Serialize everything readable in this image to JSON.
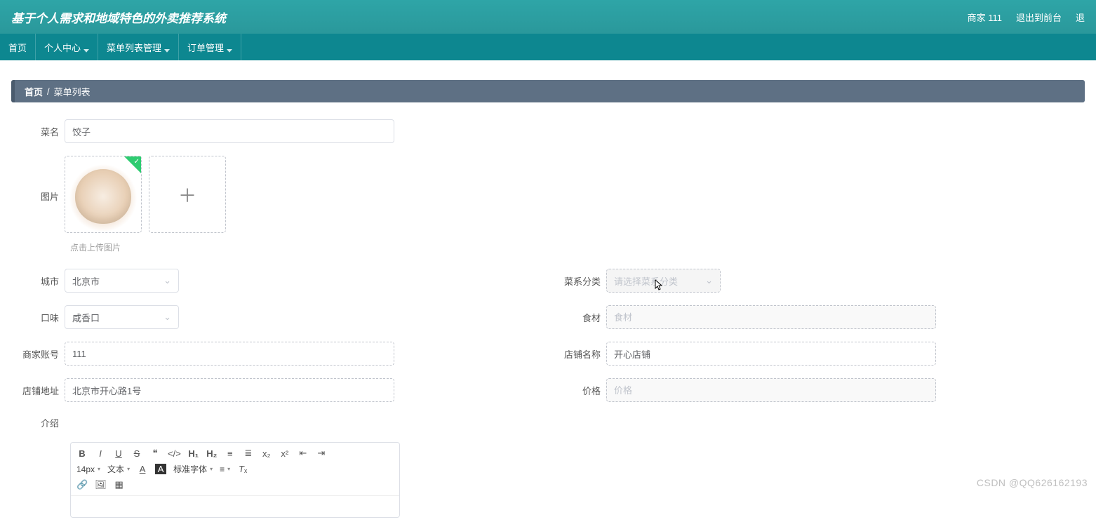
{
  "header": {
    "title": "基于个人需求和地域特色的外卖推荐系统",
    "user_label": "商家 111",
    "logout_label": "退出到前台",
    "extra_label": "退"
  },
  "nav": {
    "home": "首页",
    "personal": "个人中心",
    "menu_mgmt": "菜单列表管理",
    "order_mgmt": "订单管理"
  },
  "breadcrumb": {
    "home": "首页",
    "sep": "/",
    "current": "菜单列表"
  },
  "form": {
    "dish_name_label": "菜名",
    "dish_name_value": "饺子",
    "image_label": "图片",
    "upload_tip": "点击上传图片",
    "city_label": "城市",
    "city_value": "北京市",
    "cuisine_label": "菜系分类",
    "cuisine_placeholder": "请选择菜系分类",
    "taste_label": "口味",
    "taste_value": "咸香口",
    "ingredient_label": "食材",
    "ingredient_placeholder": "食材",
    "merchant_label": "商家账号",
    "merchant_value": "111",
    "shop_name_label": "店铺名称",
    "shop_name_value": "开心店铺",
    "shop_addr_label": "店铺地址",
    "shop_addr_value": "北京市开心路1号",
    "price_label": "价格",
    "price_placeholder": "价格",
    "intro_label": "介绍"
  },
  "editor": {
    "fontsize": "14px",
    "text_label": "文本",
    "font_label": "标准字体"
  },
  "watermark": "CSDN @QQ626162193"
}
